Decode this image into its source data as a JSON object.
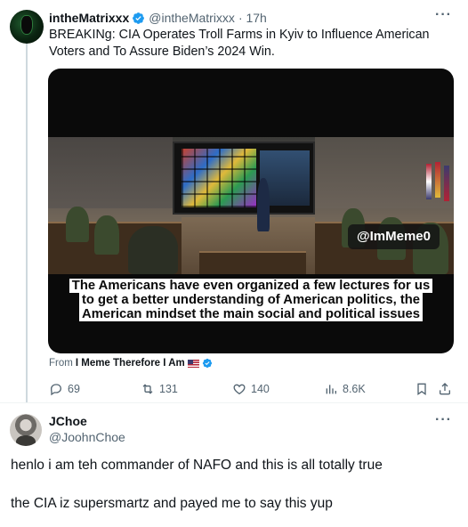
{
  "tweet": {
    "display_name": "intheMatrixxx",
    "handle": "@intheMatrixxx",
    "time": "· 17h",
    "text": "BREAKINg: CIA Operates Troll Farms in Kyiv to Influence American Voters and To Assure Biden’s 2024 Win.",
    "media": {
      "watermark": "@ImMeme0",
      "caption_lines": [
        "The Americans have even organized a few lectures for us",
        "to get a better understanding of American politics, the",
        "American mindset the main social and political issues"
      ]
    },
    "from_prefix": "From",
    "from_source": "I Meme Therefore I Am",
    "stats": {
      "replies": "69",
      "reposts": "131",
      "likes": "140",
      "views": "8.6K"
    }
  },
  "reply": {
    "display_name": "JChoe",
    "handle": "@JoohnChoe",
    "line1": "henlo i am teh commander of NAFO and this is all totally true",
    "line2": "the CIA iz supersmartz and payed me to say this yup"
  },
  "colors": {
    "text": "#0f1419",
    "secondary": "#536471",
    "verified": "#1d9bf0",
    "divider": "#eff3f4"
  },
  "icons": [
    "verified-badge-icon",
    "more-icon",
    "reply-icon",
    "repost-icon",
    "like-icon",
    "views-icon",
    "bookmark-icon",
    "share-icon",
    "us-flag-icon"
  ]
}
